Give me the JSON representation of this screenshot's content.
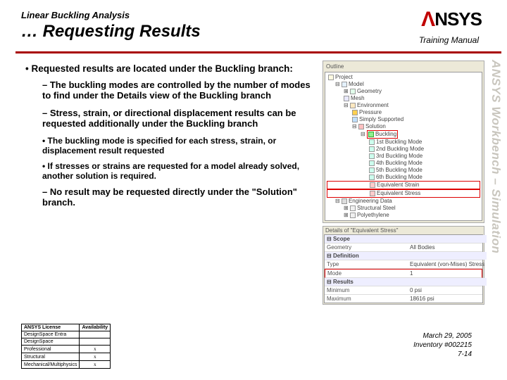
{
  "pretitle": "Linear Buckling Analysis",
  "title": "… Requesting Results",
  "logo_text": "NSYS",
  "training_manual": "Training Manual",
  "sidebar": "ANSYS Workbench – Simulation",
  "bullets": {
    "b1": "Requested results are located under the Buckling branch:",
    "b2a": "The buckling modes are controlled by the number of modes to find under the Details view of the Buckling branch",
    "b2b": "Stress, strain, or directional displacement results can be requested additionally under the Buckling branch",
    "b3a": "The buckling mode is specified for each stress, strain, or displacement result requested",
    "b3b": "If stresses or strains are requested for a model already solved, another solution is required.",
    "b2c": "No result may be requested directly under the \"Solution\" branch."
  },
  "outline": {
    "title": "Outline",
    "project": "Project",
    "model": "Model",
    "geometry": "Geometry",
    "mesh": "Mesh",
    "environment": "Environment",
    "pressure": "Pressure",
    "simply": "Simply Supported",
    "solution": "Solution",
    "buckling": "Buckling",
    "bm1": "1st Buckling Mode",
    "bm2": "2nd Buckling Mode",
    "bm3": "3rd Buckling Mode",
    "bm4": "4th Buckling Mode",
    "bm5": "5th Buckling Mode",
    "bm6": "6th Buckling Mode",
    "eqstrain": "Equivalent Strain",
    "eqstress": "Equivalent Stress",
    "engdata": "Engineering Data",
    "mat1": "Structural Steel",
    "mat2": "Polyethylene"
  },
  "details": {
    "title": "Details of \"Equivalent Stress\"",
    "scope_h": "Scope",
    "geometry_k": "Geometry",
    "geometry_v": "All Bodies",
    "def_h": "Definition",
    "type_k": "Type",
    "type_v": "Equivalent (von-Mises) Stress",
    "mode_k": "Mode",
    "mode_v": "1",
    "res_h": "Results",
    "min_k": "Minimum",
    "min_v": "0 psi",
    "max_k": "Maximum",
    "max_v": "18616 psi"
  },
  "license_table": {
    "h1": "ANSYS License",
    "h2": "Availability",
    "r1": "DesignSpace Entra",
    "r2": "DesignSpace",
    "r3": "Professional",
    "r4": "Structural",
    "r5": "Mechanical/Multiphysics",
    "x": "x"
  },
  "footer": {
    "date": "March 29, 2005",
    "inv": "Inventory #002215",
    "page": "7-14"
  }
}
